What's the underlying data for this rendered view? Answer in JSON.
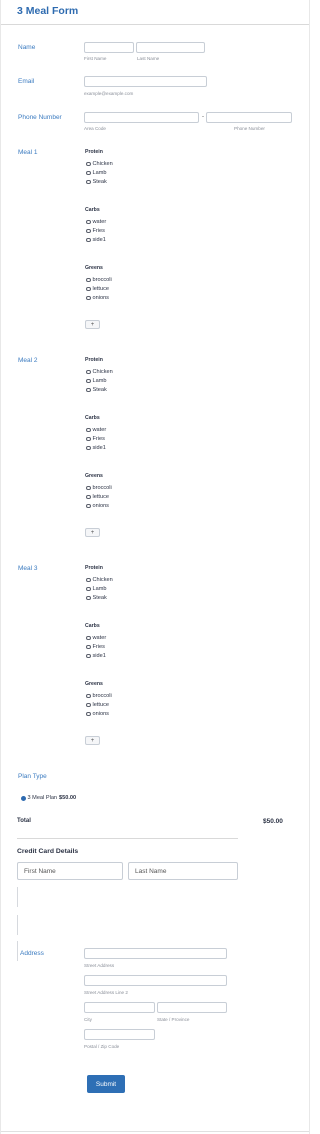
{
  "form": {
    "title": "3 Meal Form"
  },
  "name": {
    "label": "Name",
    "first_sub": "First Name",
    "last_sub": "Last Name"
  },
  "email": {
    "label": "Email",
    "sub": "example@example.com"
  },
  "phone": {
    "label": "Phone Number",
    "dash": "-",
    "area_sub": "Area Code",
    "number_sub": "Phone Number"
  },
  "meals": [
    {
      "label": "Meal 1"
    },
    {
      "label": "Meal 2"
    },
    {
      "label": "Meal 3"
    }
  ],
  "meal_groups": {
    "protein": {
      "title": "Protein",
      "options": [
        "Chicken",
        "Lamb",
        "Steak"
      ]
    },
    "carbs": {
      "title": "Carbs",
      "options": [
        "water",
        "Fries",
        "side1"
      ]
    },
    "greens": {
      "title": "Greens",
      "options": [
        "broccoli",
        "lettuce",
        "onions"
      ]
    },
    "add_label": "+"
  },
  "plan": {
    "label": "Plan Type",
    "option": "3 Meal Plan",
    "price": "$50.00"
  },
  "total": {
    "label": "Total",
    "value": "$50.00"
  },
  "credit_card": {
    "title": "Credit Card Details",
    "first_placeholder": "First Name",
    "last_placeholder": "Last Name"
  },
  "address": {
    "label": "Address",
    "street_sub": "Street Address",
    "street2_sub": "Street Address Line 2",
    "city_sub": "City",
    "state_sub": "State / Province",
    "zip_sub": "Postal / Zip Code"
  },
  "submit": {
    "label": "Submit"
  },
  "colors": {
    "accent": "#2e6bb0",
    "label": "#3b7bc0",
    "button": "#2e6fb5"
  }
}
